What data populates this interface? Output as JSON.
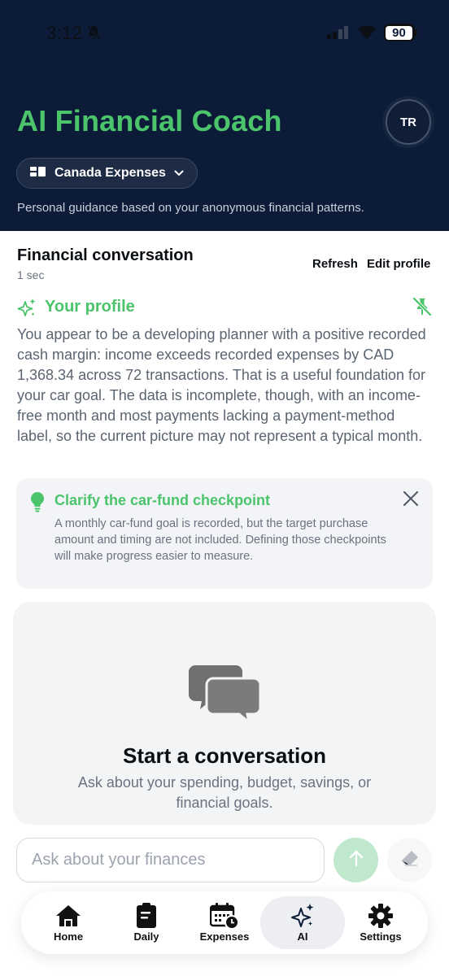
{
  "status_bar": {
    "time": "3:12",
    "battery": "90"
  },
  "header": {
    "title": "AI Financial Coach",
    "avatar_initials": "TR",
    "project_selector": "Canada Expenses",
    "subtitle": "Personal guidance based on your anonymous financial patterns."
  },
  "conversation": {
    "title": "Financial conversation",
    "updated": "1 sec",
    "refresh_label": "Refresh",
    "edit_profile_label": "Edit profile"
  },
  "profile": {
    "title": "Your profile",
    "body": "You appear to be a developing planner with a positive recorded cash margin: income exceeds recorded expenses by CAD 1,368.34 across 72 transactions. That is a useful foundation for your car goal. The data is incomplete, though, with an income-free month and most payments lacking a payment-method label, so the current picture may not represent a typical month."
  },
  "tip": {
    "title": "Clarify the car-fund checkpoint",
    "body": "A monthly car-fund goal is recorded, but the target purchase amount and timing are not included. Defining those checkpoints will make progress easier to measure."
  },
  "empty_chat": {
    "title": "Start a conversation",
    "subtitle": "Ask about your spending, budget, savings, or financial goals."
  },
  "composer": {
    "placeholder": "Ask about your finances"
  },
  "tabs": [
    {
      "label": "Home",
      "icon": "home-icon"
    },
    {
      "label": "Daily",
      "icon": "clipboard-icon"
    },
    {
      "label": "Expenses",
      "icon": "calendar-clock-icon"
    },
    {
      "label": "AI",
      "icon": "sparkles-icon",
      "active": true
    },
    {
      "label": "Settings",
      "icon": "gear-icon"
    }
  ],
  "colors": {
    "accent": "#4cc46c",
    "header_bg": "#0c1c38"
  }
}
